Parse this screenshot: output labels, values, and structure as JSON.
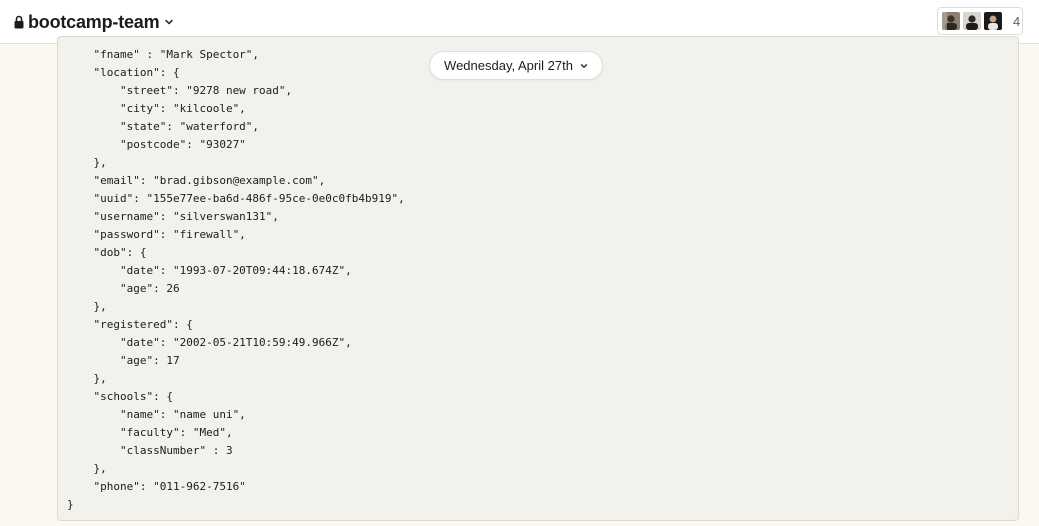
{
  "header": {
    "channel_name": "bootcamp-team",
    "member_count": "4",
    "icons": [
      "lock-icon",
      "chevron-down-icon"
    ]
  },
  "date_divider": {
    "label": "Wednesday, April 27th"
  },
  "code_block": {
    "lines": [
      "    \"fname\" : \"Mark Spector\",",
      "    \"location\": {",
      "        \"street\": \"9278 new road\",",
      "        \"city\": \"kilcoole\",",
      "        \"state\": \"waterford\",",
      "        \"postcode\": \"93027\"",
      "    },",
      "    \"email\": \"brad.gibson@example.com\",",
      "    \"uuid\": \"155e77ee-ba6d-486f-95ce-0e0c0fb4b919\",",
      "    \"username\": \"silverswan131\",",
      "    \"password\": \"firewall\",",
      "    \"dob\": {",
      "        \"date\": \"1993-07-20T09:44:18.674Z\",",
      "        \"age\": 26",
      "    },",
      "    \"registered\": {",
      "        \"date\": \"2002-05-21T10:59:49.966Z\",",
      "        \"age\": 17",
      "    },",
      "    \"schools\": {",
      "        \"name\": \"name uni\",",
      "        \"faculty\": \"Med\",",
      "        \"classNumber\" : 3",
      "    },",
      "    \"phone\": \"011-962-7516\"",
      "}"
    ]
  },
  "colors": {
    "page_background": "#fcf8f1",
    "code_background": "#f3f1ec",
    "text": "#1d1c1d"
  }
}
